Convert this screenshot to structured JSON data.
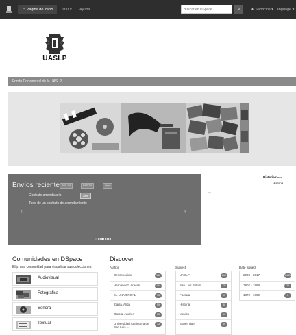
{
  "navbar": {
    "home": "Página de inicio",
    "listar": "Listar ▾",
    "ayuda": "Ayuda",
    "search_placeholder": "Buscar en DSpace",
    "user": "Servicios ▾",
    "language": "Language ▾"
  },
  "logo": {
    "text": "UASLP"
  },
  "breadcrumb": "Fondo Documental de la UASLP",
  "carousel": {
    "title": "Envíos recientes",
    "btn_rss1": "RSS 1.0",
    "btn_rss2": "RSS 2.0",
    "btn_atom": "Atom",
    "item_title": "Contrato arrendatario",
    "see": "See",
    "item_line2": "Todo de un contrato de arrendamiento"
  },
  "news": {
    "title": "Historia r......",
    "subtitle": "Historia ..."
  },
  "communities": {
    "title": "Comunidades en DSpace",
    "subtitle": "Elija una comunidad para visualizar sus colecciones.",
    "items": [
      {
        "label": "Audiovisual"
      },
      {
        "label": "Fotografica"
      },
      {
        "label": "Sonora"
      },
      {
        "label": "Textual"
      }
    ]
  },
  "discover": {
    "title": "Discover",
    "author": {
      "head": "Author",
      "rows": [
        {
          "label": "Desconocido",
          "count": "150"
        },
        {
          "label": "Hernández, Araceli",
          "count": "104"
        },
        {
          "label": "EL UNIVERSAL",
          "count": "73"
        },
        {
          "label": "Ibarra, Alida",
          "count": "59"
        },
        {
          "label": "Garcia, Andrés",
          "count": "33"
        },
        {
          "label": "Universidad Autónoma de San Luis ...",
          "count": "33"
        }
      ]
    },
    "subject": {
      "head": "Subject",
      "rows": [
        {
          "label": "UASLP",
          "count": "200"
        },
        {
          "label": "San Luis Potosí",
          "count": "131"
        },
        {
          "label": "Factura",
          "count": "97"
        },
        {
          "label": "Historia",
          "count": "80"
        },
        {
          "label": "Mexico",
          "count": "67"
        },
        {
          "label": "Super Tiger",
          "count": "49"
        }
      ]
    },
    "date": {
      "head": "Date issued",
      "rows": [
        {
          "label": "2000 - 2017",
          "count": "2489"
        },
        {
          "label": "1902 - 1999",
          "count": "28"
        },
        {
          "label": "1870 - 1899",
          "count": "3"
        }
      ]
    }
  }
}
